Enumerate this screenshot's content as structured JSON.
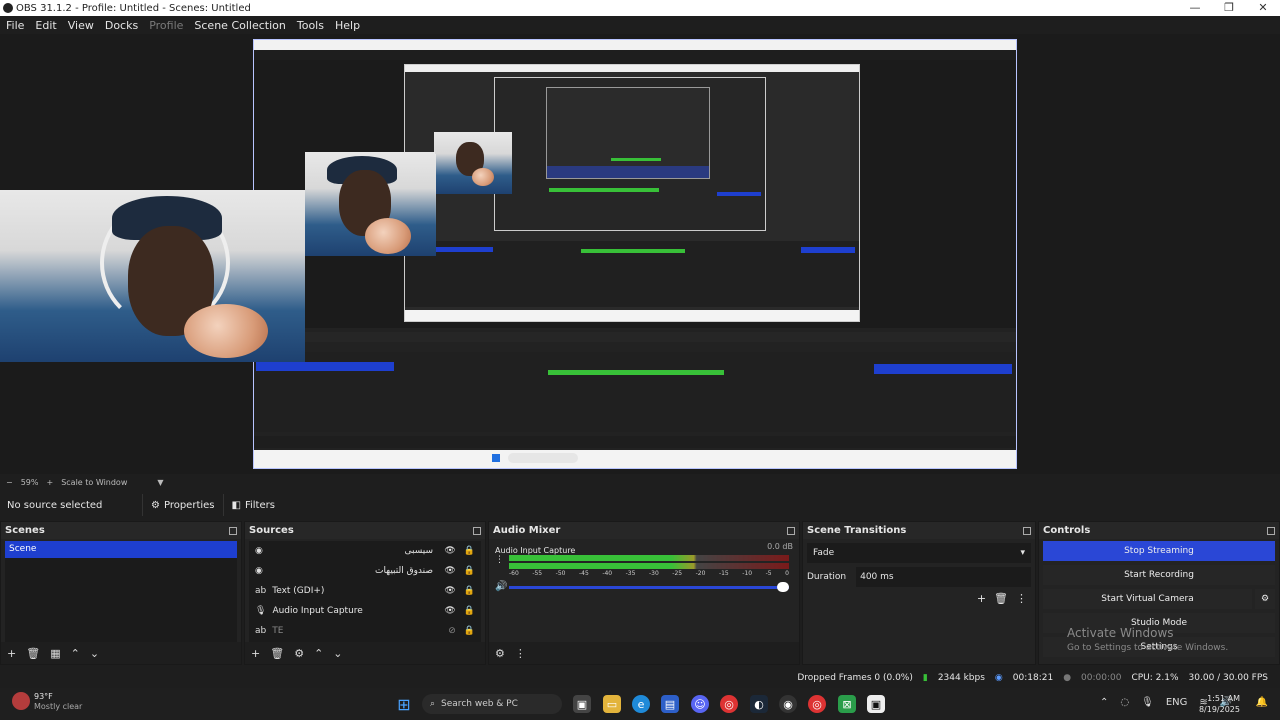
{
  "window": {
    "title": "OBS 31.1.2 - Profile: Untitled - Scenes: Untitled",
    "controls": [
      "—",
      "❐",
      "✕"
    ]
  },
  "menu": [
    "File",
    "Edit",
    "View",
    "Docks",
    "Profile",
    "Scene Collection",
    "Tools",
    "Help"
  ],
  "preview_bar": {
    "zoom_minus": "−",
    "zoom": "59%",
    "zoom_plus": "+",
    "scale": "Scale to Window",
    "scale_caret": "▼"
  },
  "source_bar": {
    "no_source": "No source selected",
    "properties": "Properties",
    "filters": "Filters"
  },
  "scenes": {
    "title": "Scenes",
    "items": [
      "Scene"
    ]
  },
  "sources": {
    "title": "Sources",
    "items": [
      {
        "label": "سيسبی",
        "icon": "browser-icon"
      },
      {
        "label": "صندوق التبيهات",
        "icon": "browser-icon"
      },
      {
        "label": "Text (GDI+)",
        "icon": "text-icon"
      },
      {
        "label": "Audio Input Capture",
        "icon": "microphone-icon"
      },
      {
        "label": "TE",
        "icon": "text-icon"
      }
    ]
  },
  "audio_mixer": {
    "title": "Audio Mixer",
    "channel": "Audio Input Capture",
    "db": "0.0 dB",
    "ticks": [
      "-60",
      "-55",
      "-50",
      "-45",
      "-40",
      "-35",
      "-30",
      "-25",
      "-20",
      "-15",
      "-10",
      "-5",
      "0"
    ],
    "level": 0.66,
    "volume": 1.0
  },
  "transitions": {
    "title": "Scene Transitions",
    "selected": "Fade",
    "duration_label": "Duration",
    "duration_value": "400 ms"
  },
  "controls": {
    "title": "Controls",
    "buttons": [
      "Stop Streaming",
      "Start Recording",
      "Start Virtual Camera",
      "Studio Mode",
      "Settings"
    ],
    "watermark_title": "Activate Windows",
    "watermark_sub": "Go to Settings to activate Windows."
  },
  "status": {
    "dropped": "Dropped Frames 0 (0.0%)",
    "bitrate": "2344 kbps",
    "stream_time": "00:18:21",
    "rec_time": "00:00:00",
    "cpu": "CPU: 2.1%",
    "fps": "30.00 / 30.00 FPS"
  },
  "taskbar": {
    "weather_temp": "93°F",
    "weather_desc": "Mostly clear",
    "search": "Search web & PC",
    "lang": "ENG",
    "time": "1:51 AM",
    "date": "8/19/2025"
  },
  "colors": {
    "accent": "#1e3fcf",
    "meter_green": "#38c038"
  }
}
